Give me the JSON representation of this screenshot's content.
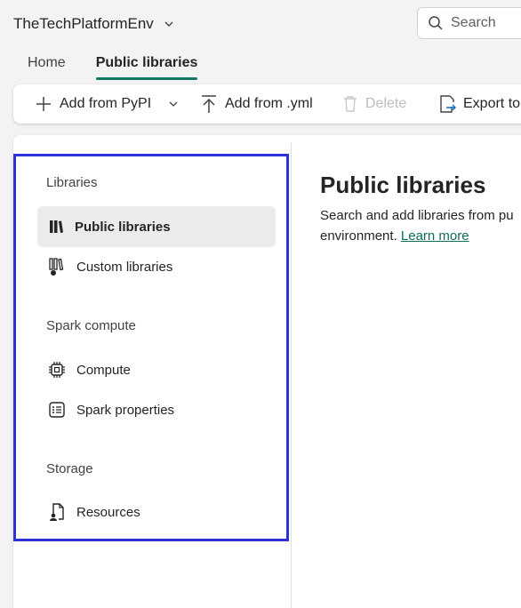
{
  "header": {
    "workspace_name": "TheTechPlatformEnv",
    "search_placeholder": "Search"
  },
  "tabs": [
    {
      "label": "Home",
      "active": false
    },
    {
      "label": "Public libraries",
      "active": true
    }
  ],
  "toolbar": {
    "add_pypi": "Add from PyPI",
    "add_yml": "Add from .yml",
    "delete": "Delete",
    "export": "Export to"
  },
  "sidebar": {
    "sections": [
      {
        "title": "Libraries",
        "items": [
          {
            "label": "Public libraries",
            "icon": "books-icon",
            "selected": true
          },
          {
            "label": "Custom libraries",
            "icon": "custom-books-icon",
            "selected": false
          }
        ]
      },
      {
        "title": "Spark compute",
        "items": [
          {
            "label": "Compute",
            "icon": "chip-icon",
            "selected": false
          },
          {
            "label": "Spark properties",
            "icon": "list-icon",
            "selected": false
          }
        ]
      },
      {
        "title": "Storage",
        "items": [
          {
            "label": "Resources",
            "icon": "document-person-icon",
            "selected": false
          }
        ]
      }
    ]
  },
  "content": {
    "title": "Public libraries",
    "description_line1": "Search and add libraries from pu",
    "description_line2": "environment.",
    "learn_more": "Learn more"
  },
  "colors": {
    "accent": "#117865",
    "link": "#0f6b5b",
    "highlight_border": "#2b33d6",
    "selected_bg": "#ebebeb"
  }
}
